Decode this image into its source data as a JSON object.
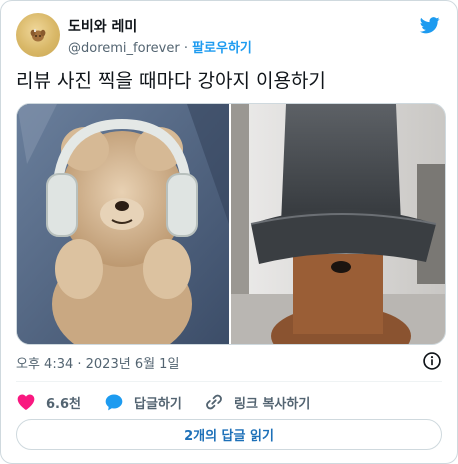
{
  "user": {
    "name": "도비와 레미",
    "handle": "@doremi_forever",
    "separator": "·",
    "follow_label": "팔로우하기"
  },
  "tweet": {
    "text": "리뷰 사진 찍을 때마다 강아지 이용하기",
    "timestamp": "오후 4:34 · 2023년 6월 1일"
  },
  "actions": {
    "like_count": "6.6천",
    "reply_label": "답글하기",
    "copy_link_label": "링크 복사하기"
  },
  "replies_button": "2개의 답글 읽기",
  "colors": {
    "twitter_blue": "#1d9bf0",
    "like_pink": "#f91880",
    "secondary_text": "#536471",
    "border": "#cfd9de"
  },
  "icons": [
    "twitter-bird-icon",
    "info-icon",
    "heart-icon",
    "reply-bubble-icon",
    "link-icon"
  ]
}
